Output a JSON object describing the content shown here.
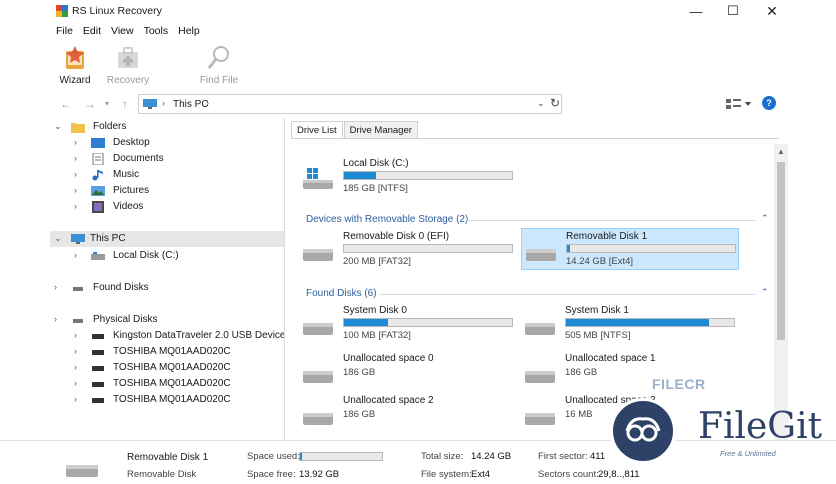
{
  "window": {
    "title": "RS Linux Recovery",
    "minimize": "—",
    "maximize": "☐",
    "close": "✕"
  },
  "menu": [
    "File",
    "Edit",
    "View",
    "Tools",
    "Help"
  ],
  "toolbar": {
    "wizard": "Wizard",
    "recovery": "Recovery",
    "find_file": "Find File"
  },
  "address": {
    "location": "This PC"
  },
  "tree": {
    "folders": "Folders",
    "desktop": "Desktop",
    "documents": "Documents",
    "music": "Music",
    "pictures": "Pictures",
    "videos": "Videos",
    "this_pc": "This PC",
    "local_disk": "Local Disk (C:)",
    "found_disks": "Found Disks",
    "physical_disks": "Physical Disks",
    "physical": [
      "Kingston DataTraveler 2.0 USB Device",
      "TOSHIBA MQ01AAD020C",
      "TOSHIBA MQ01AAD020C",
      "TOSHIBA MQ01AAD020C",
      "TOSHIBA MQ01AAD020C"
    ]
  },
  "tabs": {
    "drive_list": "Drive List",
    "drive_manager": "Drive Manager"
  },
  "sections": {
    "removable": "Devices with Removable Storage (2)",
    "found": "Found Disks (6)"
  },
  "drives": {
    "local_c": {
      "name": "Local Disk (C:)",
      "info": "185 GB [NTFS]",
      "used_fraction": 0.19
    },
    "rem0": {
      "name": "Removable Disk 0 (EFI)",
      "info": "200 MB [FAT32]",
      "used_fraction": 0.0
    },
    "rem1": {
      "name": "Removable Disk 1",
      "info": "14.24 GB [Ext4]",
      "used_fraction": 0.02
    },
    "sys0": {
      "name": "System Disk 0",
      "info": "100 MB [FAT32]",
      "used_fraction": 0.26
    },
    "sys1": {
      "name": "System Disk 1",
      "info": "505 MB [NTFS]",
      "used_fraction": 0.85
    },
    "unalloc0": {
      "name": "Unallocated space 0",
      "info": "186 GB"
    },
    "unalloc1": {
      "name": "Unallocated space 1",
      "info": "186 GB"
    },
    "unalloc2": {
      "name": "Unallocated space 2",
      "info": "186 GB"
    },
    "unalloc3": {
      "name": "Unallocated space 3",
      "info": "16 MB"
    }
  },
  "status": {
    "name": "Removable Disk 1",
    "type": "Removable Disk",
    "space_used_label": "Space used:",
    "space_used_fraction": 0.02,
    "space_free_label": "Space free:",
    "space_free_value": "13.92 GB",
    "total_size_label": "Total size:",
    "total_size_value": "14.24 GB",
    "file_system_label": "File system:",
    "file_system_value": "Ext4",
    "first_sector_label": "First sector:",
    "first_sector_value": "411",
    "sectors_count_label": "Sectors count:",
    "sectors_count_value": "29,8..,811"
  },
  "watermark": {
    "filecr": "FILECR",
    "filegit": "FileGit",
    "tagline": "Free & Unlimited"
  },
  "colors": {
    "accent": "#1f8ad6",
    "selection": "#cce8ff",
    "section_text": "#2c5f9e"
  }
}
